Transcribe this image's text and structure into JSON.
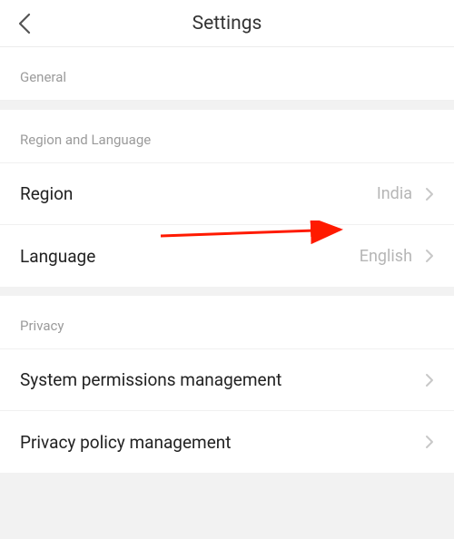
{
  "header": {
    "title": "Settings"
  },
  "sections": {
    "general": {
      "header": "General"
    },
    "region_language": {
      "header": "Region and Language",
      "region_label": "Region",
      "region_value": "India",
      "language_label": "Language",
      "language_value": "English"
    },
    "privacy": {
      "header": "Privacy",
      "syspm_label": "System permissions management",
      "privpm_label": "Privacy policy management"
    }
  }
}
